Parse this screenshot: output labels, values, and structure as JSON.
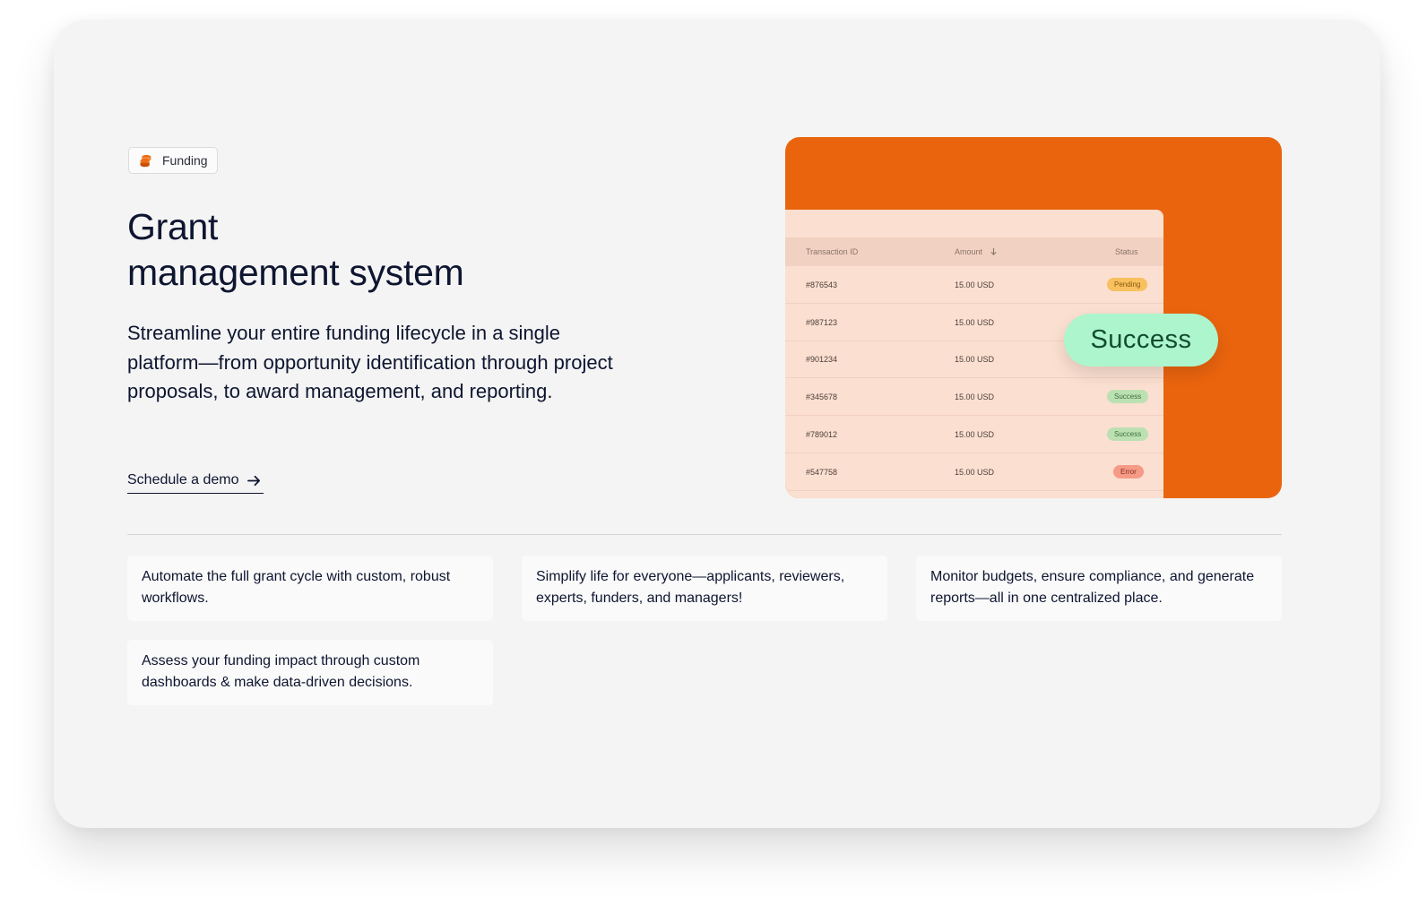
{
  "badge": {
    "label": "Funding",
    "icon": "coins-stack-icon"
  },
  "hero": {
    "title_line1": "Grant",
    "title_line2": "management system",
    "description": "Streamline your entire funding lifecycle in a single platform—from opportunity identification through project proposals, to award management, and reporting.",
    "cta_label": "Schedule a demo"
  },
  "table": {
    "headers": {
      "id": "Transaction ID",
      "amount": "Amount",
      "status": "Status"
    },
    "rows": [
      {
        "id": "#876543",
        "amount": "15.00 USD",
        "status": "Pending"
      },
      {
        "id": "#987123",
        "amount": "15.00 USD",
        "status": ""
      },
      {
        "id": "#901234",
        "amount": "15.00 USD",
        "status": ""
      },
      {
        "id": "#345678",
        "amount": "15.00 USD",
        "status": "Success"
      },
      {
        "id": "#789012",
        "amount": "15.00 USD",
        "status": "Success"
      },
      {
        "id": "#547758",
        "amount": "15.00 USD",
        "status": "Error"
      }
    ]
  },
  "success_badge": "Success",
  "features": [
    "Automate the full grant cycle with custom, robust workflows.",
    "Simplify life for everyone—applicants, reviewers, experts, funders, and managers!",
    "Monitor budgets, ensure compliance, and generate reports—all in one centralized place.",
    "Assess your funding impact through custom dashboards & make data-driven decisions."
  ],
  "colors": {
    "accent_orange": "#ea640e",
    "table_bg": "#fbdfd0",
    "success_green": "#acf5cd",
    "text_dark": "#0e1530"
  }
}
